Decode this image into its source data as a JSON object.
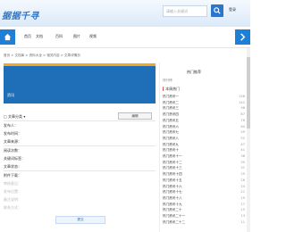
{
  "header": {
    "logo_text": "据据千寻",
    "search_placeholder": "请输入关键词",
    "link_text": "登录"
  },
  "nav": {
    "items": [
      "首页",
      "文档",
      "百科",
      "图片",
      "视频"
    ]
  },
  "breadcrumb": "首页 > 文档库 > 资料大全 > 相关内容 > 文章详情页",
  "main": {
    "banner_title": "资讯",
    "fields": [
      "□ 文章分类 ▾",
      "发布人：",
      "发布时间：",
      "文章来源：",
      "阅读次数：",
      "关键词标签：",
      "文章状态：",
      "附件下载：",
      "审核意见：",
      "发布位置：",
      "备注说明：",
      "联系方式："
    ],
    "edit_label": "编辑",
    "submit_label": "提交"
  },
  "sidebar": {
    "title": "热门推荐",
    "note": "排行榜",
    "subtitle": "本周热门",
    "items": [
      {
        "label": "热门资讯一",
        "count": "156"
      },
      {
        "label": "热门资讯二",
        "count": "142"
      },
      {
        "label": "热门资讯三",
        "count": "98"
      },
      {
        "label": "热门资讯四",
        "count": "87"
      },
      {
        "label": "热门资讯五",
        "count": "76"
      },
      {
        "label": "热门资讯六",
        "count": "64"
      },
      {
        "label": "热门资讯七",
        "count": "59"
      },
      {
        "label": "热门资讯八",
        "count": "52"
      },
      {
        "label": "热门资讯九",
        "count": "47"
      },
      {
        "label": "热门资讯十",
        "count": "41"
      },
      {
        "label": "热门资讯十一",
        "count": "38"
      },
      {
        "label": "热门资讯十二",
        "count": "35"
      },
      {
        "label": "热门资讯十三",
        "count": "31"
      },
      {
        "label": "热门资讯十四",
        "count": "29"
      },
      {
        "label": "热门资讯十五",
        "count": "26"
      },
      {
        "label": "热门资讯十六",
        "count": "24"
      },
      {
        "label": "热门资讯十七",
        "count": "21"
      },
      {
        "label": "热门资讯十八",
        "count": "19"
      },
      {
        "label": "热门资讯十九",
        "count": "17"
      },
      {
        "label": "热门资讯二十",
        "count": "15"
      },
      {
        "label": "热门资讯二十一",
        "count": "13"
      },
      {
        "label": "热门资讯二十二",
        "count": "11"
      }
    ]
  },
  "colors": {
    "accent": "#1e7fd6",
    "banner": "#1f6fb8",
    "banner_tag": "#f5a623",
    "mark": "#e05a47"
  },
  "icons": {
    "search": "search-icon",
    "home": "home-icon",
    "nav_right": "chevron-right-icon"
  }
}
